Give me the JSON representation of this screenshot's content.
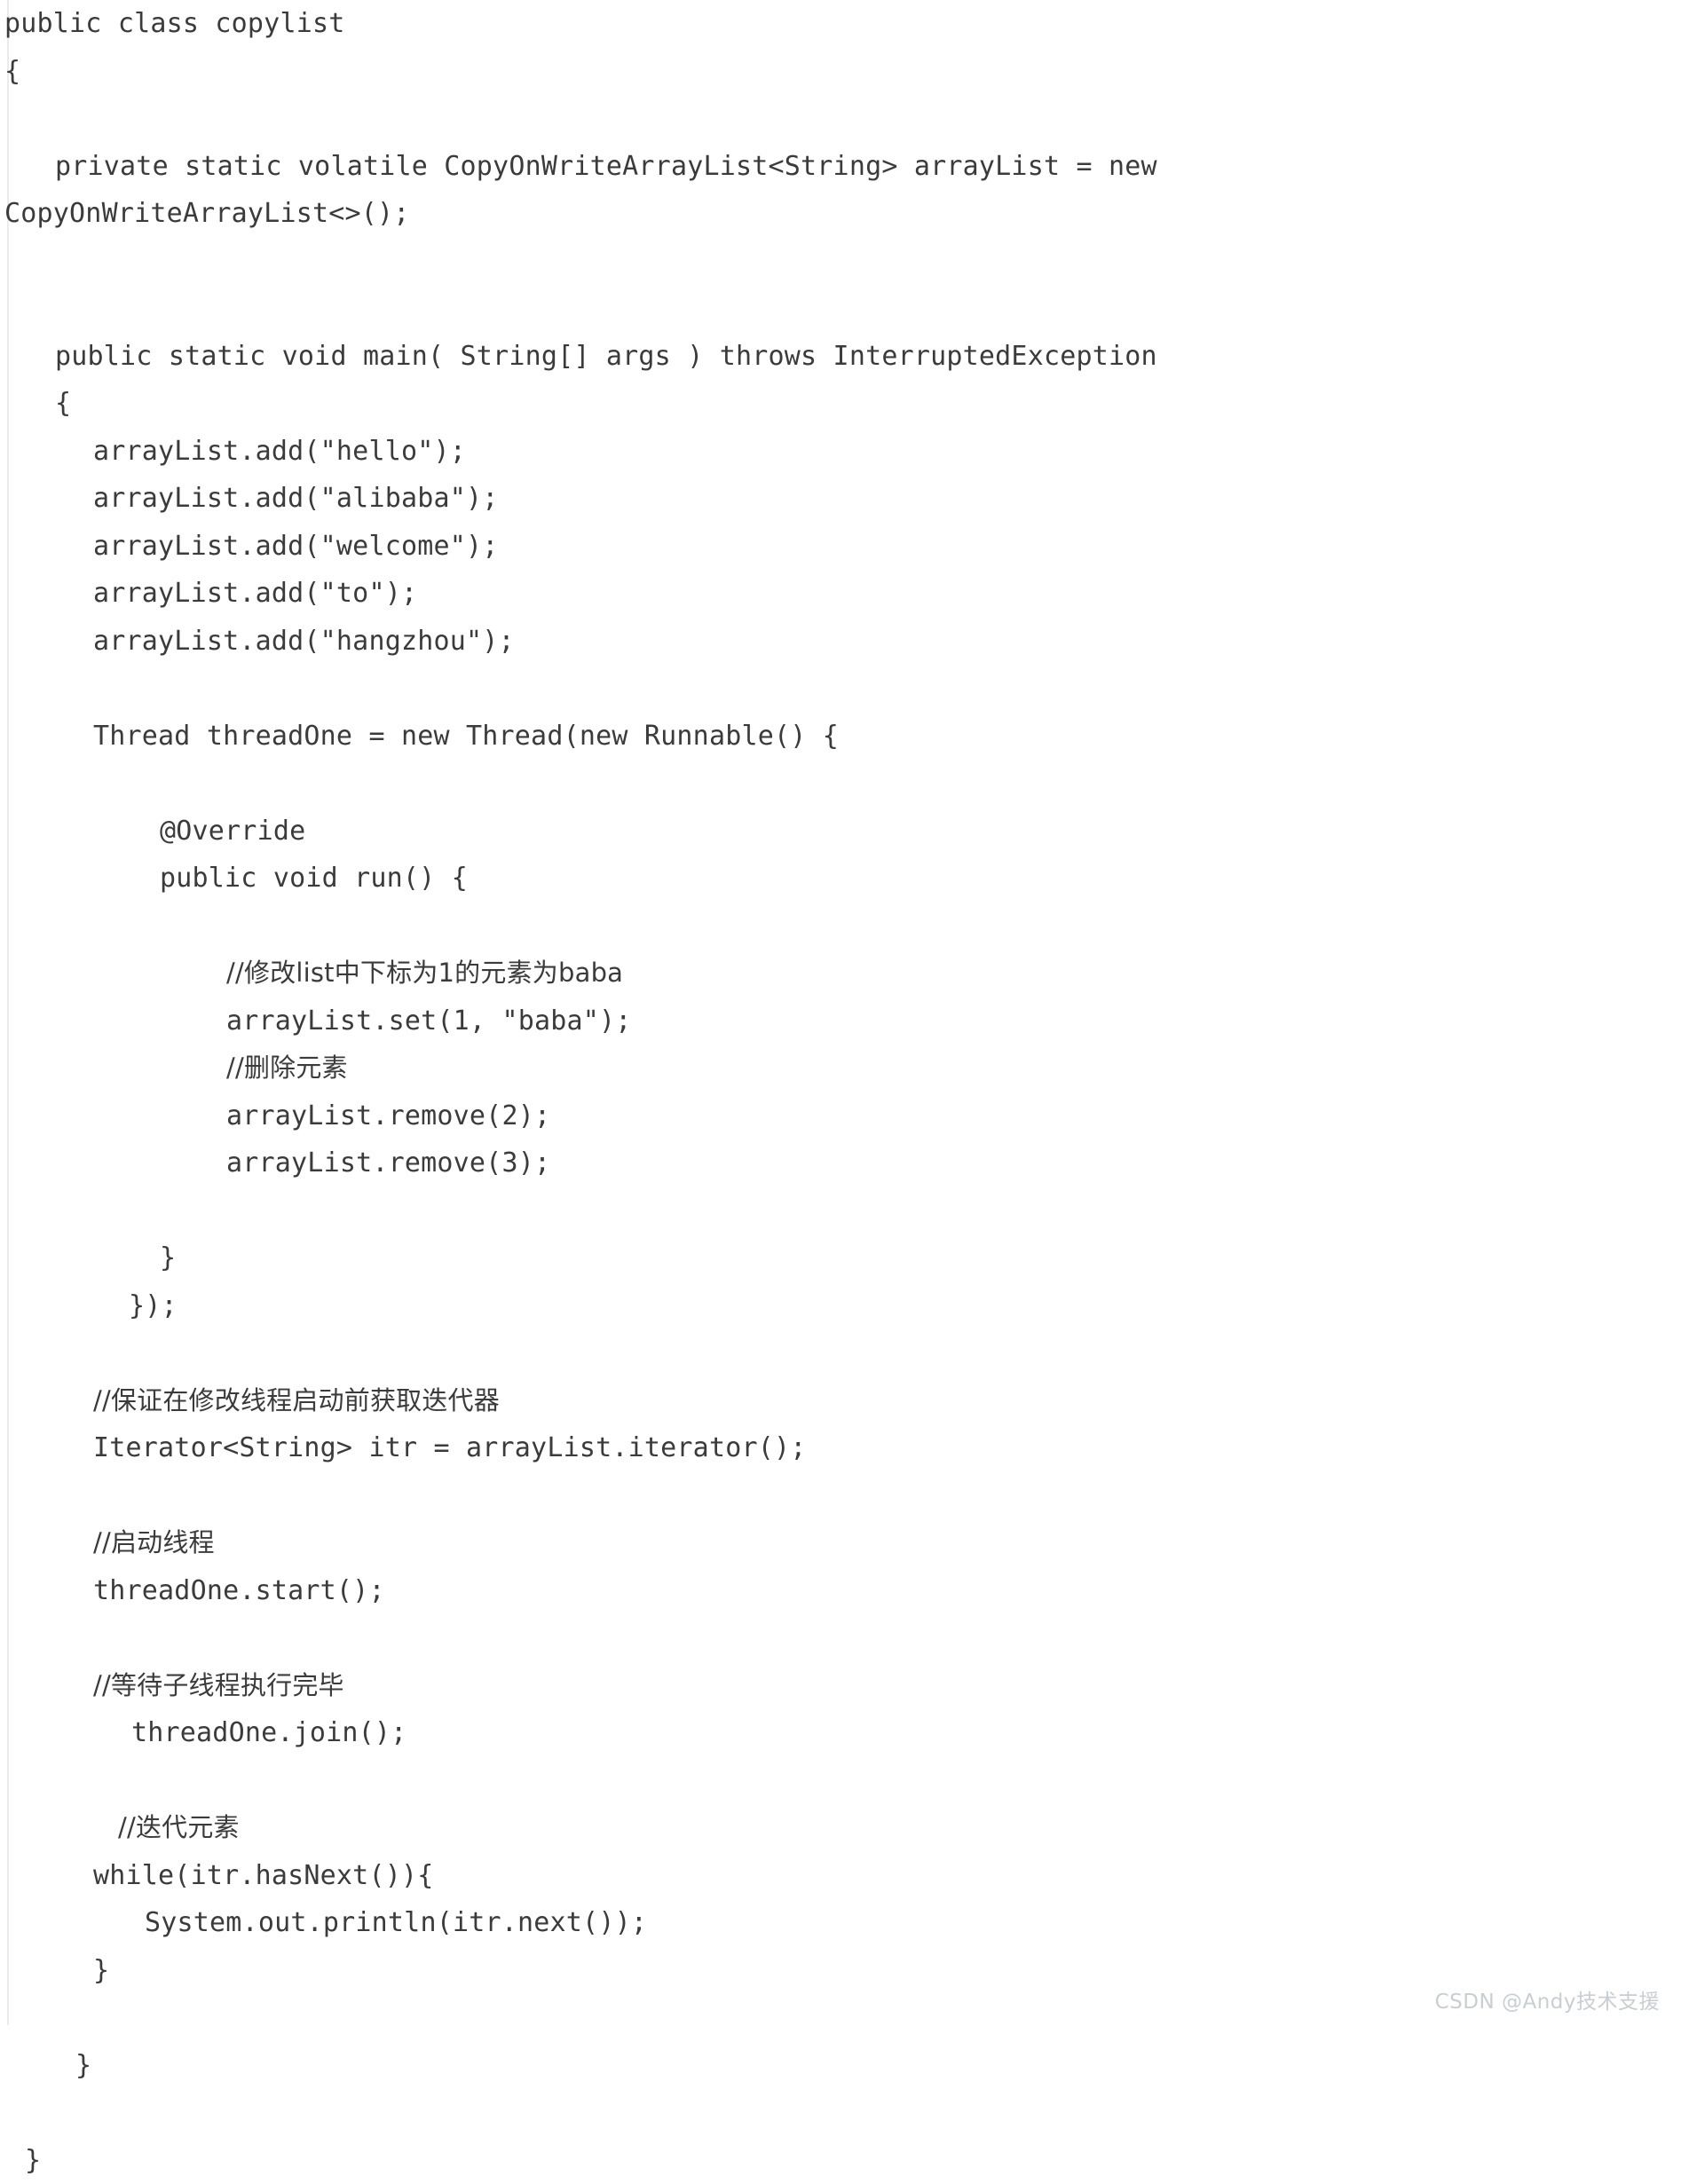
{
  "document": {
    "kind": "code-listing",
    "language": "Java",
    "class_name": "copylist",
    "text_color": "#3b3b3b",
    "background_color": "#ffffff"
  },
  "watermark": {
    "text": "CSDN @Andy技术支援",
    "color": "#c9cdd4"
  },
  "code": {
    "lines": [
      {
        "indent": "i0",
        "text": "public class copylist"
      },
      {
        "indent": "i0",
        "text": "{"
      },
      {
        "indent": "i0",
        "text": ""
      },
      {
        "indent": "i2",
        "text": "private static volatile CopyOnWriteArrayList<String> arrayList = new"
      },
      {
        "indent": "i0",
        "text": "CopyOnWriteArrayList<>();"
      },
      {
        "indent": "i0",
        "text": ""
      },
      {
        "indent": "i0",
        "text": ""
      },
      {
        "indent": "i2",
        "text": "public static void main( String[] args ) throws InterruptedException"
      },
      {
        "indent": "i2",
        "text": "{"
      },
      {
        "indent": "i4",
        "text": "arrayList.add(\"hello\");"
      },
      {
        "indent": "i4",
        "text": "arrayList.add(\"alibaba\");"
      },
      {
        "indent": "i4",
        "text": "arrayList.add(\"welcome\");"
      },
      {
        "indent": "i4",
        "text": "arrayList.add(\"to\");"
      },
      {
        "indent": "i4",
        "text": "arrayList.add(\"hangzhou\");"
      },
      {
        "indent": "i0",
        "text": ""
      },
      {
        "indent": "i4",
        "text": "Thread threadOne = new Thread(new Runnable() {"
      },
      {
        "indent": "i0",
        "text": ""
      },
      {
        "indent": "i8",
        "text": "@Override"
      },
      {
        "indent": "i8",
        "text": "public void run() {"
      },
      {
        "indent": "i0",
        "text": ""
      },
      {
        "indent": "i9",
        "text": "//修改list中下标为1的元素为baba",
        "cjk": true
      },
      {
        "indent": "i9",
        "text": "arrayList.set(1, \"baba\");"
      },
      {
        "indent": "i9",
        "text": "//删除元素",
        "cjk": true
      },
      {
        "indent": "i9",
        "text": "arrayList.remove(2);"
      },
      {
        "indent": "i9",
        "text": "arrayList.remove(3);"
      },
      {
        "indent": "i0",
        "text": ""
      },
      {
        "indent": "i8",
        "text": "}"
      },
      {
        "indent": "i6",
        "text": "});"
      },
      {
        "indent": "i0",
        "text": ""
      },
      {
        "indent": "i4",
        "text": "//保证在修改线程启动前获取迭代器",
        "cjk": true
      },
      {
        "indent": "i4",
        "text": "Iterator<String> itr = arrayList.iterator();"
      },
      {
        "indent": "i0",
        "text": ""
      },
      {
        "indent": "i4",
        "text": "//启动线程",
        "cjk": true
      },
      {
        "indent": "i4",
        "text": "threadOne.start();"
      },
      {
        "indent": "i0",
        "text": ""
      },
      {
        "indent": "i4",
        "text": "//等待子线程执行完毕",
        "cjk": true
      },
      {
        "indent": "i10",
        "text": "threadOne.join();"
      },
      {
        "indent": "i0",
        "text": ""
      },
      {
        "indent": "i5",
        "text": "//迭代元素",
        "cjk": true
      },
      {
        "indent": "i4",
        "text": "while(itr.hasNext()){"
      },
      {
        "indent": "i7",
        "text": "System.out.println(itr.next());"
      },
      {
        "indent": "i4",
        "text": "}"
      },
      {
        "indent": "i0",
        "text": ""
      },
      {
        "indent": "i3",
        "text": "}"
      },
      {
        "indent": "i0",
        "text": ""
      },
      {
        "indent": "i1",
        "text": "}"
      }
    ]
  }
}
